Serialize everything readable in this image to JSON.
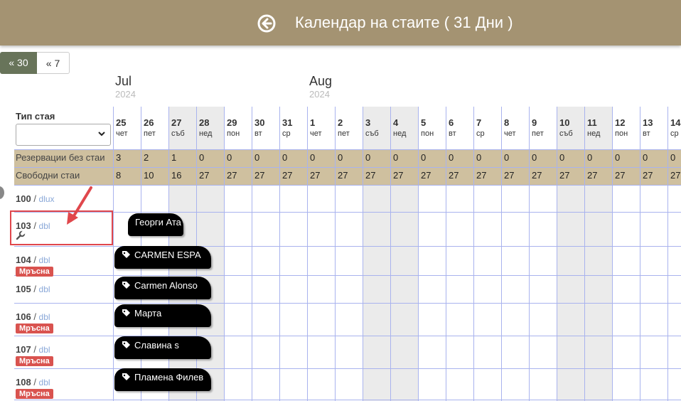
{
  "header": {
    "title": "Календар на стаите ( 31 Дни )"
  },
  "range_buttons": {
    "b30": "« 30",
    "b7": "« 7"
  },
  "months": [
    {
      "name": "Jul",
      "year": "2024"
    },
    {
      "name": "Aug",
      "year": "2024"
    }
  ],
  "filter": {
    "label": "Тип стая",
    "value": ""
  },
  "days": [
    {
      "num": "25",
      "name": "чет"
    },
    {
      "num": "26",
      "name": "пет"
    },
    {
      "num": "27",
      "name": "съб"
    },
    {
      "num": "28",
      "name": "нед"
    },
    {
      "num": "29",
      "name": "пон"
    },
    {
      "num": "30",
      "name": "вт"
    },
    {
      "num": "31",
      "name": "ср"
    },
    {
      "num": "1",
      "name": "чет"
    },
    {
      "num": "2",
      "name": "пет"
    },
    {
      "num": "3",
      "name": "съб"
    },
    {
      "num": "4",
      "name": "нед"
    },
    {
      "num": "5",
      "name": "пон"
    },
    {
      "num": "6",
      "name": "вт"
    },
    {
      "num": "7",
      "name": "ср"
    },
    {
      "num": "8",
      "name": "чет"
    },
    {
      "num": "9",
      "name": "пет"
    },
    {
      "num": "10",
      "name": "съб"
    },
    {
      "num": "11",
      "name": "нед"
    },
    {
      "num": "12",
      "name": "пон"
    },
    {
      "num": "13",
      "name": "вт"
    },
    {
      "num": "14",
      "name": "ср"
    }
  ],
  "summary": {
    "unassigned_label": "Резервации без стаи",
    "unassigned": [
      "3",
      "2",
      "1",
      "0",
      "0",
      "0",
      "0",
      "0",
      "0",
      "0",
      "0",
      "0",
      "0",
      "0",
      "0",
      "0",
      "0",
      "0",
      "0",
      "0",
      "0"
    ],
    "free_label": "Свободни стаи",
    "free": [
      "8",
      "10",
      "16",
      "27",
      "27",
      "27",
      "27",
      "27",
      "27",
      "27",
      "27",
      "27",
      "27",
      "27",
      "27",
      "27",
      "27",
      "27",
      "27",
      "27",
      "27"
    ]
  },
  "rooms": [
    {
      "num": "100",
      "type": "dlux",
      "status": ""
    },
    {
      "num": "103",
      "type": "dbl",
      "status": ""
    },
    {
      "num": "104",
      "type": "dbl",
      "status": "Мръсна"
    },
    {
      "num": "105",
      "type": "dbl",
      "status": ""
    },
    {
      "num": "106",
      "type": "dbl",
      "status": "Мръсна"
    },
    {
      "num": "107",
      "type": "dbl",
      "status": "Мръсна"
    },
    {
      "num": "108",
      "type": "dbl",
      "status": "Мръсна"
    }
  ],
  "bookings": [
    {
      "guest": "Георги Ата",
      "tagged": false
    },
    {
      "guest": "CARMEN ESPA",
      "tagged": true
    },
    {
      "guest": "Carmen Alonso",
      "tagged": true
    },
    {
      "guest": "Марта",
      "tagged": true
    },
    {
      "guest": "Славина s",
      "tagged": true
    },
    {
      "guest": "Пламена Филев",
      "tagged": true
    }
  ],
  "colors": {
    "header": "#a49372",
    "band": "#cfc09f",
    "dirty": "#d9534f",
    "weekend": "#ebebeb",
    "annotation": "#e0474c"
  }
}
